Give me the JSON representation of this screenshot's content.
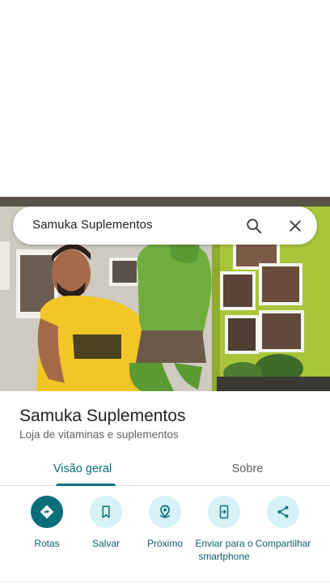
{
  "search": {
    "query": "Samuka Suplementos"
  },
  "place": {
    "name": "Samuka Suplementos",
    "category": "Loja de vitaminas e suplementos"
  },
  "tabs": [
    {
      "label": "Visão geral",
      "active": true
    },
    {
      "label": "Sobre",
      "active": false
    }
  ],
  "actions": [
    {
      "label": "Rotas",
      "icon": "directions-icon"
    },
    {
      "label": "Salvar",
      "icon": "bookmark-icon"
    },
    {
      "label": "Próximo",
      "icon": "nearby-icon"
    },
    {
      "label": "Enviar para o smartphone",
      "icon": "send-to-phone-icon"
    },
    {
      "label": "Compartilhar",
      "icon": "share-icon"
    }
  ],
  "colors": {
    "accent": "#0b6e7a",
    "action_bg": "#d6f2f7"
  }
}
